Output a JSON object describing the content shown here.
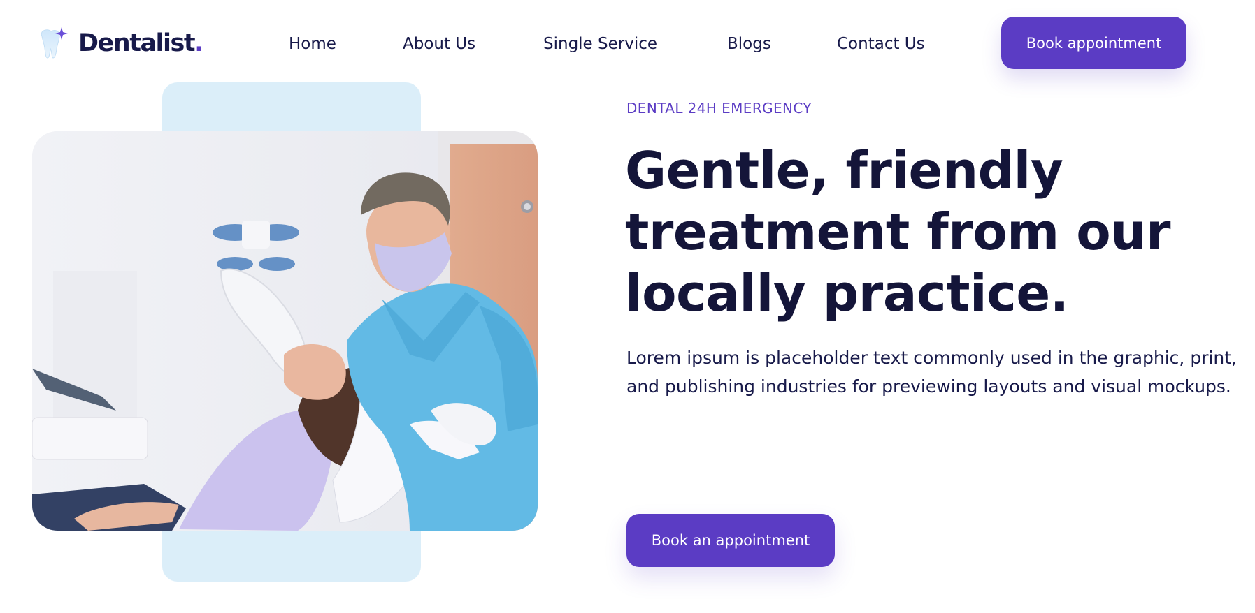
{
  "brand": {
    "name": "Dentalist",
    "dot": ".",
    "accent_color": "#5b3cc4",
    "text_color": "#181a4a"
  },
  "nav": {
    "items": [
      {
        "label": "Home"
      },
      {
        "label": "About Us"
      },
      {
        "label": "Single Service"
      },
      {
        "label": "Blogs"
      },
      {
        "label": "Contact Us"
      }
    ],
    "cta_label": "Book appointment"
  },
  "hero": {
    "eyebrow": "DENTAL 24H EMERGENCY",
    "headline": "Gentle, friendly treatment from our locally practice.",
    "description": "Lorem ipsum is placeholder text commonly used in the graphic, print, and publishing industries for previewing layouts and visual mockups.",
    "cta_label": "Book an appointment",
    "image_icon": "dentist-treating-patient-photo",
    "background_block_color": "#dbeef9"
  }
}
